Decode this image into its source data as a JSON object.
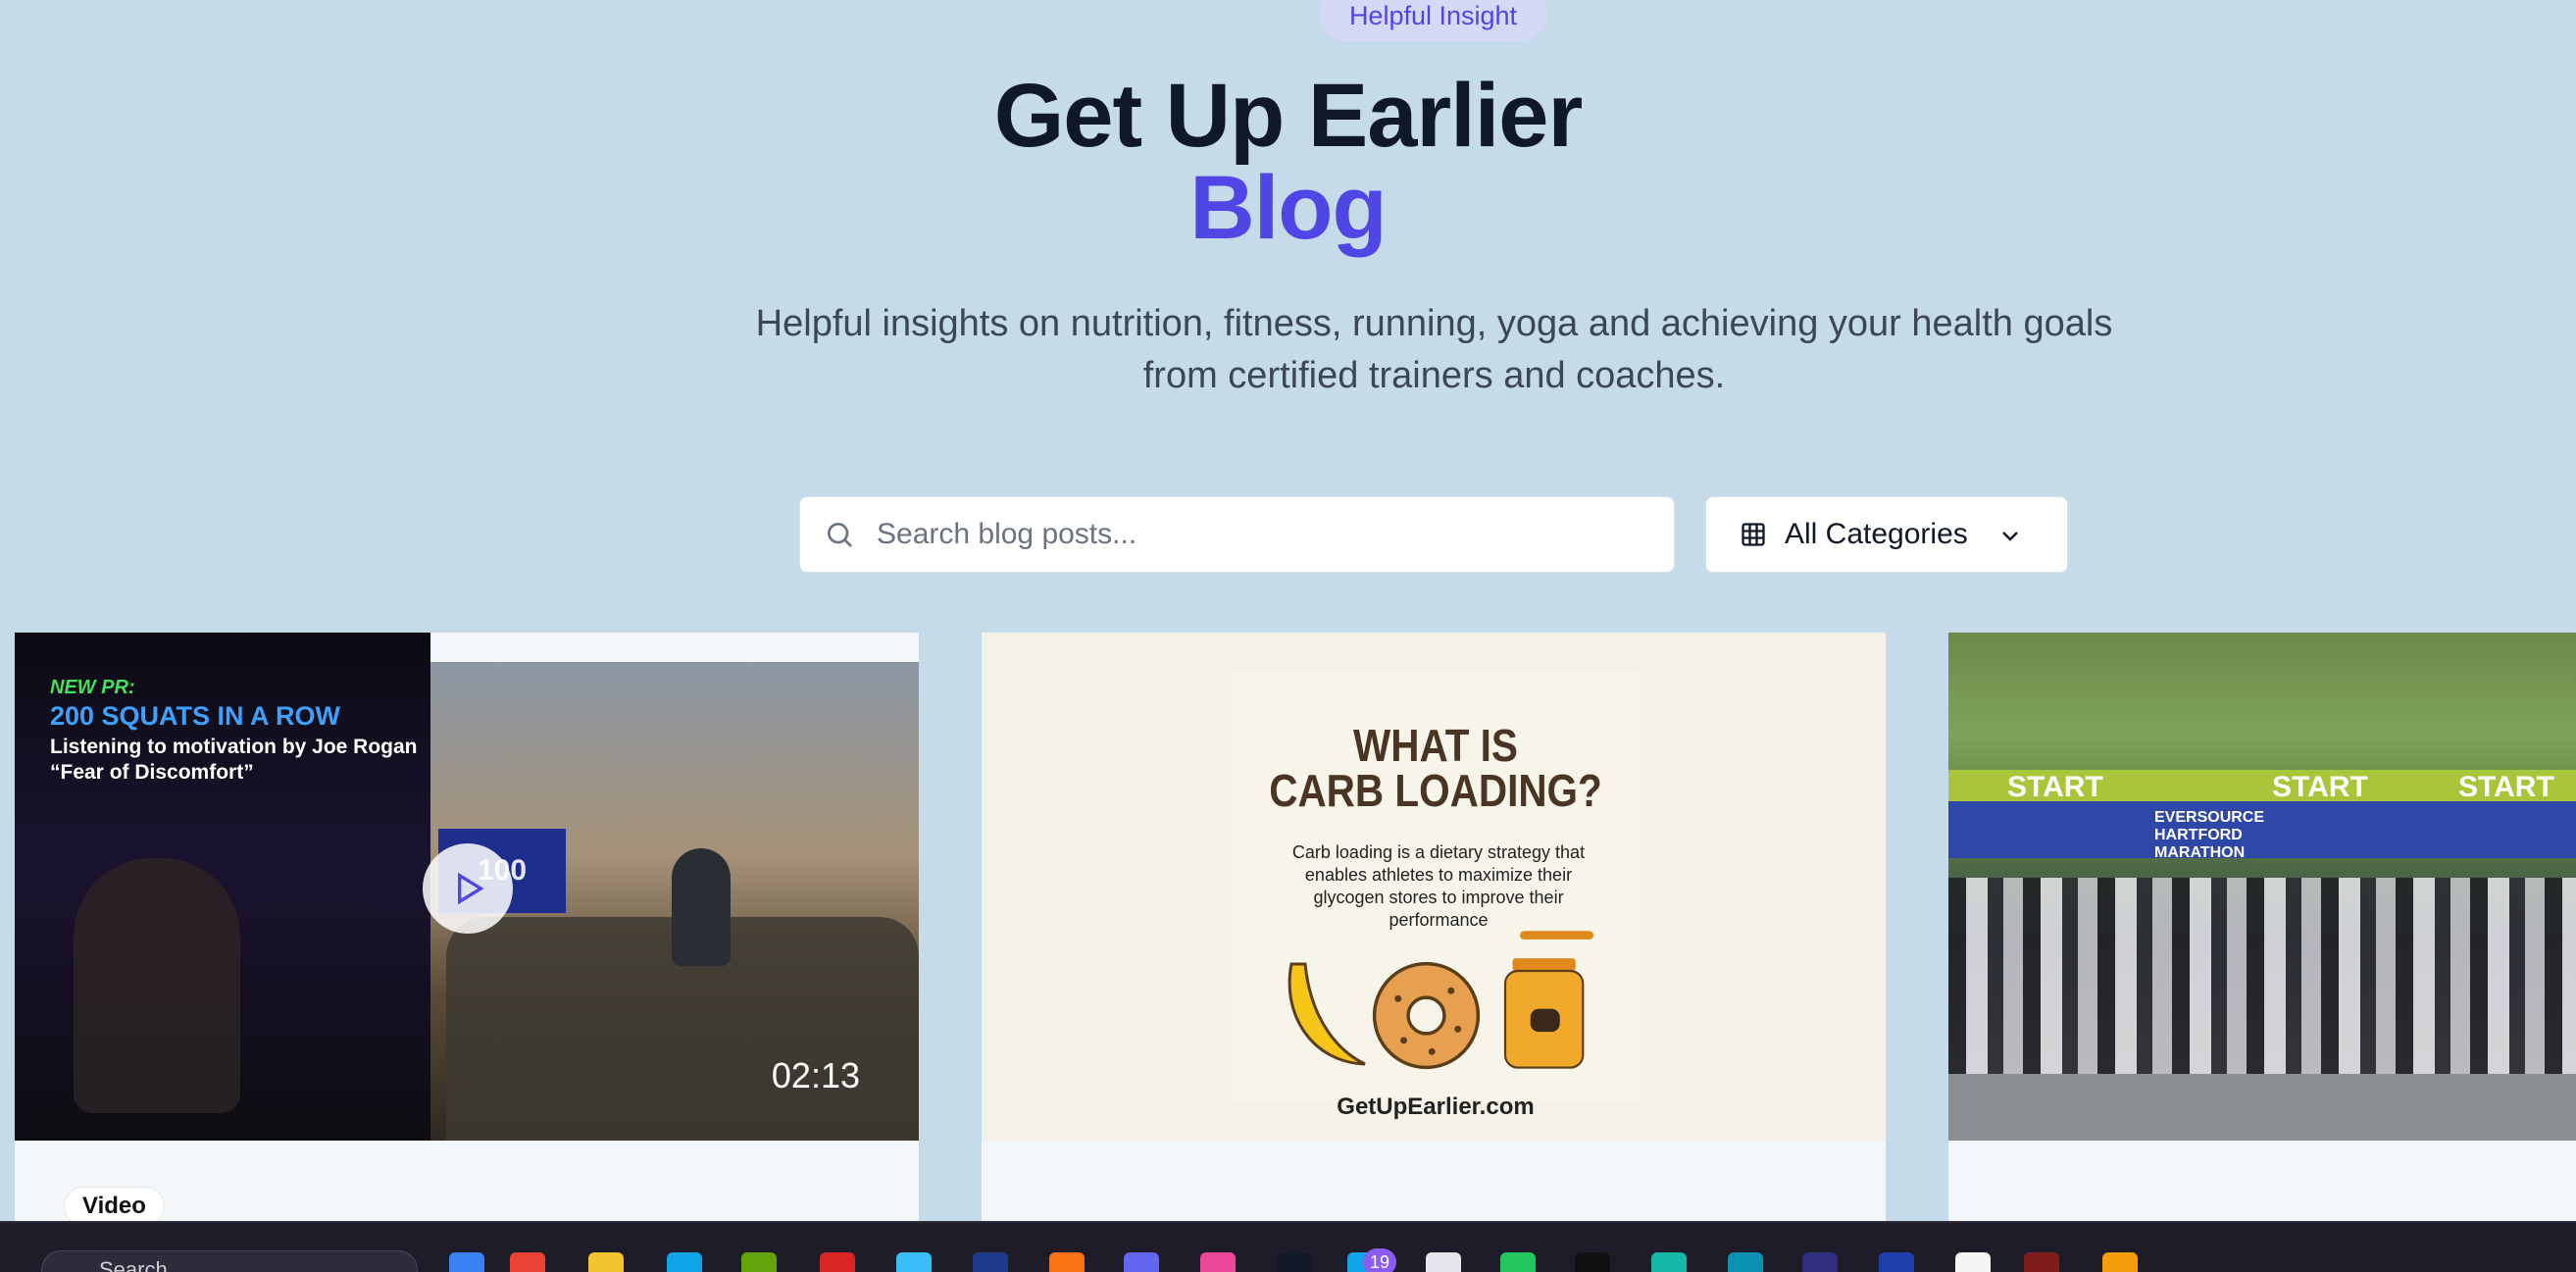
{
  "hero": {
    "badge": "Helpful Insight",
    "title": "Get Up Earlier",
    "title_accent": "Blog",
    "subtitle": "Helpful insights on nutrition, fitness, running, yoga and achieving your health goals from certified trainers and coaches."
  },
  "search": {
    "placeholder": "Search blog posts...",
    "icon": "search-icon"
  },
  "category_select": {
    "value": "All Categories",
    "icon": "grid-icon",
    "chevron": "chevron-down-icon"
  },
  "posts": [
    {
      "type_chip": "Video",
      "duration": "02:13",
      "thumb_tag": "NEW PR:",
      "thumb_headline": "200 SQUATS IN A ROW",
      "thumb_caption": "Listening to motivation by Joe Rogan “Fear of Discomfort”",
      "thumb_box": "100"
    },
    {
      "thumb_title_line1": "WHAT IS",
      "thumb_title_line2": "CARB LOADING?",
      "thumb_desc": "Carb loading is a dietary strategy that enables athletes to maximize their glycogen stores to improve their performance",
      "thumb_site": "GetUpEarlier.com"
    },
    {
      "thumb_banner": "START",
      "thumb_sponsor": "EVERSOURCE HARTFORD MARATHON"
    }
  ],
  "taskbar": {
    "search_placeholder": "Search",
    "badge_count": "19"
  },
  "colors": {
    "page_bg": "#c6dbea",
    "accent": "#4f46e5",
    "heading": "#0f172a",
    "taskbar": "#1d1c28"
  }
}
